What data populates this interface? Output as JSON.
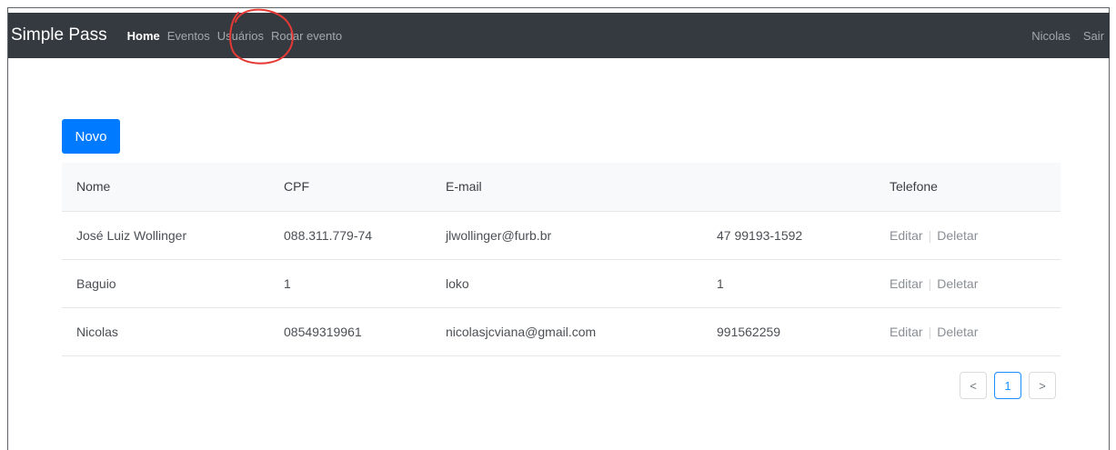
{
  "nav": {
    "brand": "Simple Pass",
    "links": [
      "Home",
      "Eventos",
      "Usuários",
      "Rodar evento"
    ],
    "user": "Nicolas",
    "logout": "Sair"
  },
  "toolbar": {
    "new_label": "Novo"
  },
  "table": {
    "headers": [
      "Nome",
      "CPF",
      "E-mail",
      "",
      "Telefone"
    ],
    "rows": [
      {
        "nome": "José Luiz Wollinger",
        "cpf": "088.311.779-74",
        "email": "jlwollinger@furb.br",
        "telefone": "47 99193-1592",
        "edit": "Editar",
        "delete": "Deletar"
      },
      {
        "nome": "Baguio",
        "cpf": "1",
        "email": "loko",
        "telefone": "1",
        "edit": "Editar",
        "delete": "Deletar"
      },
      {
        "nome": "Nicolas",
        "cpf": "08549319961",
        "email": "nicolasjcviana@gmail.com",
        "telefone": "991562259",
        "edit": "Editar",
        "delete": "Deletar"
      }
    ]
  },
  "pagination": {
    "prev": "<",
    "current": "1",
    "next": ">"
  },
  "colors": {
    "navbar": "#343a40",
    "primary": "#007bff",
    "annotation": "#e53935"
  }
}
